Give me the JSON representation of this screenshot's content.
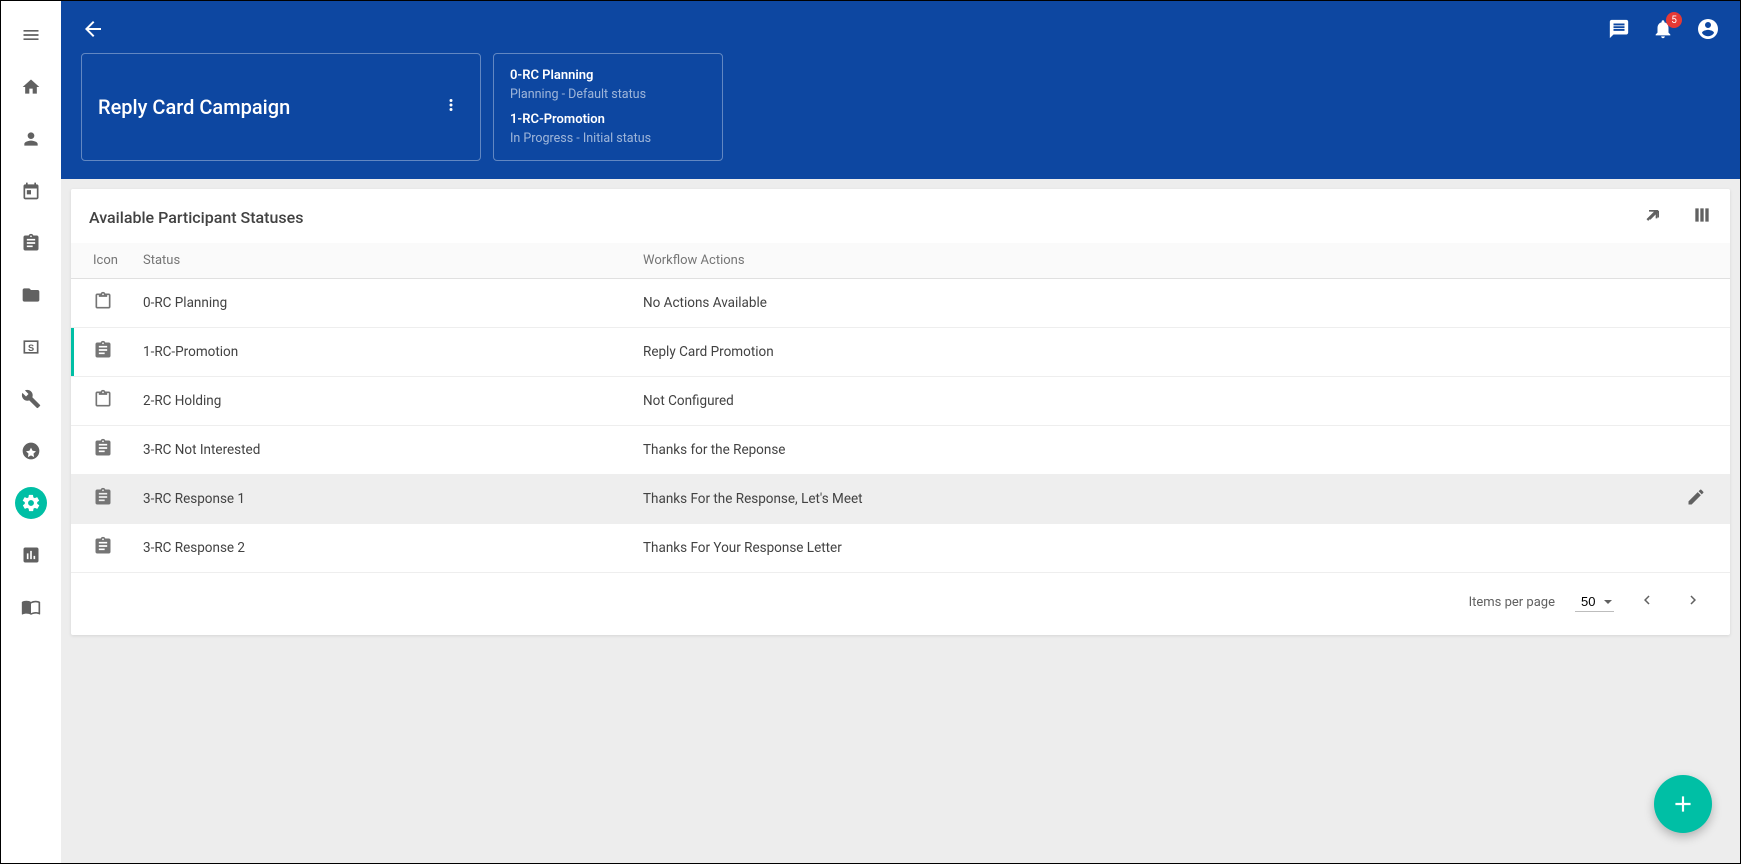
{
  "sidebar": {
    "items": [
      {
        "name": "menu"
      },
      {
        "name": "home"
      },
      {
        "name": "person"
      },
      {
        "name": "calendar"
      },
      {
        "name": "clipboard"
      },
      {
        "name": "folder"
      },
      {
        "name": "billing"
      },
      {
        "name": "wrench"
      },
      {
        "name": "star"
      },
      {
        "name": "settings",
        "active": true
      },
      {
        "name": "analytics"
      },
      {
        "name": "book"
      }
    ]
  },
  "header": {
    "notification_count": "5",
    "campaign_title": "Reply Card Campaign",
    "detail": {
      "line1_title": "0-RC Planning",
      "line1_sub": "Planning - Default status",
      "line2_title": "1-RC-Promotion",
      "line2_sub": "In Progress - Initial status"
    }
  },
  "card": {
    "title": "Available Participant Statuses",
    "columns": {
      "icon": "Icon",
      "status": "Status",
      "actions": "Workflow Actions"
    },
    "rows": [
      {
        "icon": "outline",
        "status": "0-RC Planning",
        "actions": "No Actions Available",
        "active": false,
        "hovered": false
      },
      {
        "icon": "filled",
        "status": "1-RC-Promotion",
        "actions": "Reply Card Promotion",
        "active": true,
        "hovered": false
      },
      {
        "icon": "outline",
        "status": "2-RC Holding",
        "actions": "Not Configured",
        "active": false,
        "hovered": false
      },
      {
        "icon": "filled",
        "status": "3-RC Not Interested",
        "actions": "Thanks for the Reponse",
        "active": false,
        "hovered": false
      },
      {
        "icon": "filled",
        "status": "3-RC Response 1",
        "actions": "Thanks For the Response, Let's Meet",
        "active": false,
        "hovered": true
      },
      {
        "icon": "filled",
        "status": "3-RC Response 2",
        "actions": "Thanks For Your Response Letter",
        "active": false,
        "hovered": false
      }
    ]
  },
  "paginator": {
    "label": "Items per page",
    "value": "50"
  }
}
